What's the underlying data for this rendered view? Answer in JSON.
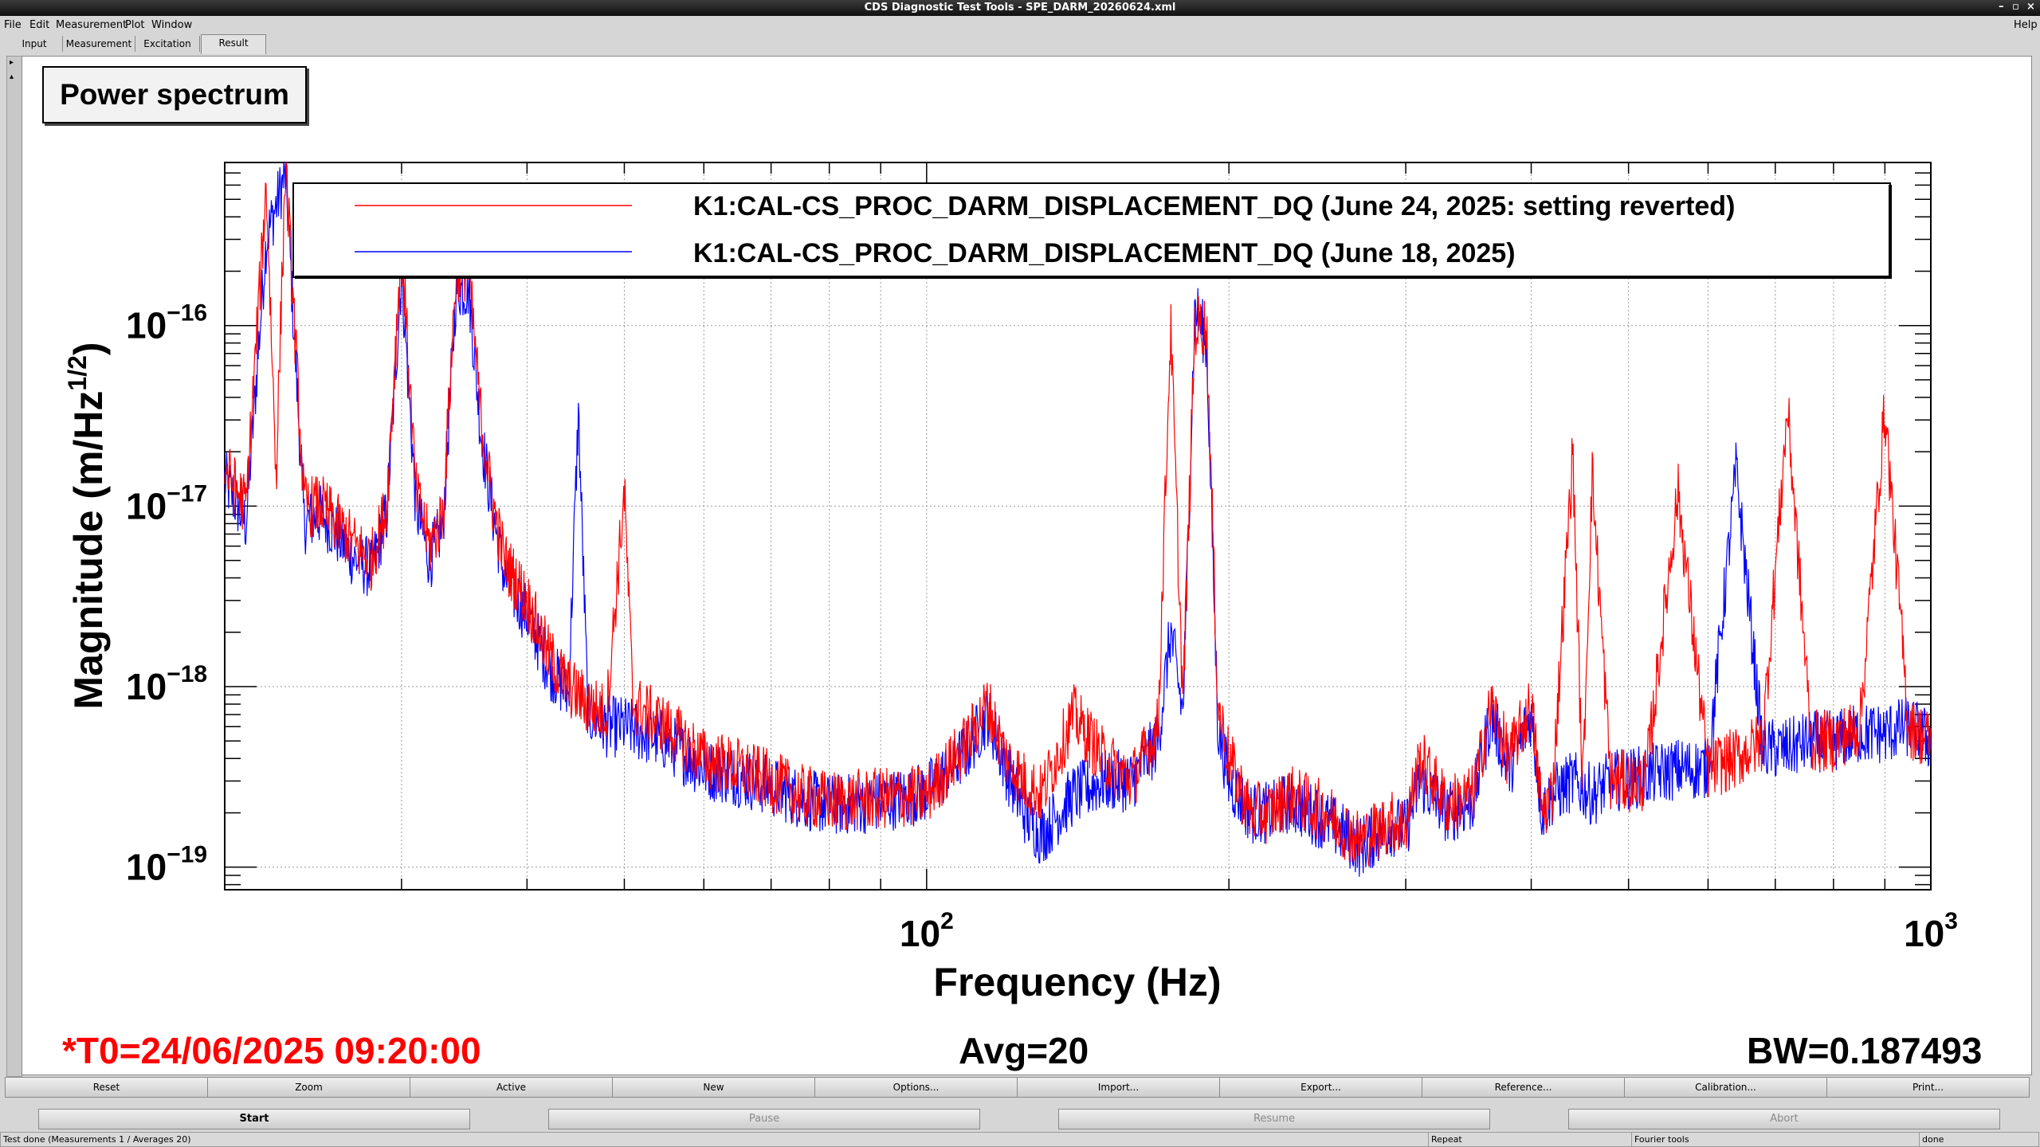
{
  "window": {
    "title": "CDS Diagnostic Test Tools - SPE_DARM_20260624.xml",
    "controls": [
      "–",
      "▫",
      "×"
    ]
  },
  "menu": {
    "items": [
      "File",
      "Edit",
      "Measurement",
      "Plot",
      "Window"
    ],
    "help": "Help"
  },
  "tabs": [
    "Input",
    "Measurement",
    "Excitation",
    "Result"
  ],
  "active_tab": "Result",
  "plot_title": "Power spectrum",
  "legend": [
    {
      "label": "K1:CAL-CS_PROC_DARM_DISPLACEMENT_DQ (June 24, 2025: setting reverted)",
      "color": "#ff0000"
    },
    {
      "label": "K1:CAL-CS_PROC_DARM_DISPLACEMENT_DQ (June 18, 2025)",
      "color": "#0000ff"
    }
  ],
  "chart_data": {
    "type": "line",
    "x_scale": "log",
    "y_scale": "log",
    "xlim": [
      20,
      1000
    ],
    "ylim": [
      7.5e-20,
      8e-16
    ],
    "xlabel": "Frequency (Hz)",
    "ylabel": "Magnitude (m/Hz^1/2)",
    "x_tick_labels": [
      {
        "value": 100,
        "base": "10",
        "exp": "2"
      },
      {
        "value": 1000,
        "base": "10",
        "exp": "3"
      }
    ],
    "y_tick_labels": [
      {
        "value": 1e-16,
        "base": "10",
        "exp": "−16"
      },
      {
        "value": 1e-17,
        "base": "10",
        "exp": "−17"
      },
      {
        "value": 1e-18,
        "base": "10",
        "exp": "−18"
      },
      {
        "value": 1e-19,
        "base": "10",
        "exp": "−19"
      }
    ],
    "grid": true,
    "series": [
      {
        "name": "K1:CAL-CS_PROC_DARM_DISPLACEMENT_DQ (June 24, 2025: setting reverted)",
        "color": "#ff0000",
        "points": [
          [
            20,
            1.6e-17
          ],
          [
            21,
            1e-17
          ],
          [
            22,
            6e-16
          ],
          [
            22.5,
            1.5e-17
          ],
          [
            23,
            8e-16
          ],
          [
            24,
            1e-17
          ],
          [
            25,
            1e-17
          ],
          [
            27,
            6e-18
          ],
          [
            28,
            5e-18
          ],
          [
            29,
            1e-17
          ],
          [
            30,
            3e-16
          ],
          [
            31,
            1.2e-17
          ],
          [
            32,
            6e-18
          ],
          [
            33,
            9e-18
          ],
          [
            34,
            2e-16
          ],
          [
            35,
            2e-16
          ],
          [
            36,
            3e-17
          ],
          [
            37,
            1e-17
          ],
          [
            38,
            5e-18
          ],
          [
            40,
            3e-18
          ],
          [
            42,
            1.5e-18
          ],
          [
            44,
            1e-18
          ],
          [
            46,
            8e-19
          ],
          [
            48,
            7e-19
          ],
          [
            50,
            1.2e-17
          ],
          [
            51,
            8e-19
          ],
          [
            55,
            6e-19
          ],
          [
            60,
            4e-19
          ],
          [
            65,
            3.5e-19
          ],
          [
            70,
            3e-19
          ],
          [
            75,
            2.5e-19
          ],
          [
            80,
            2.3e-19
          ],
          [
            90,
            2.4e-19
          ],
          [
            100,
            2.5e-19
          ],
          [
            110,
            5e-19
          ],
          [
            115,
            8e-19
          ],
          [
            120,
            4e-19
          ],
          [
            125,
            3e-19
          ],
          [
            130,
            2.5e-19
          ],
          [
            140,
            7e-19
          ],
          [
            150,
            4e-19
          ],
          [
            160,
            3e-19
          ],
          [
            170,
            6e-19
          ],
          [
            175,
            1e-16
          ],
          [
            180,
            8e-19
          ],
          [
            185,
            1e-16
          ],
          [
            190,
            1e-16
          ],
          [
            195,
            8e-19
          ],
          [
            200,
            4e-19
          ],
          [
            210,
            2e-19
          ],
          [
            220,
            2e-19
          ],
          [
            230,
            2.5e-19
          ],
          [
            250,
            2e-19
          ],
          [
            270,
            1.4e-19
          ],
          [
            290,
            1.8e-19
          ],
          [
            300,
            1.7e-19
          ],
          [
            310,
            4e-19
          ],
          [
            330,
            2.2e-19
          ],
          [
            350,
            2.5e-19
          ],
          [
            365,
            8e-19
          ],
          [
            380,
            4e-19
          ],
          [
            400,
            8e-19
          ],
          [
            410,
            2e-19
          ],
          [
            420,
            2.6e-19
          ],
          [
            440,
            2e-17
          ],
          [
            450,
            2.6e-19
          ],
          [
            460,
            1.5e-17
          ],
          [
            480,
            3e-19
          ],
          [
            520,
            3e-19
          ],
          [
            560,
            1.2e-17
          ],
          [
            600,
            3.5e-19
          ],
          [
            640,
            4e-19
          ],
          [
            680,
            5e-19
          ],
          [
            720,
            3.5e-17
          ],
          [
            760,
            5e-19
          ],
          [
            800,
            5e-19
          ],
          [
            850,
            6e-19
          ],
          [
            900,
            3.5e-17
          ],
          [
            950,
            6e-19
          ],
          [
            1000,
            5e-19
          ]
        ]
      },
      {
        "name": "K1:CAL-CS_PROC_DARM_DISPLACEMENT_DQ (June 18, 2025)",
        "color": "#0000ff",
        "points": [
          [
            20,
            1.4e-17
          ],
          [
            21,
            8e-18
          ],
          [
            22,
            3e-16
          ],
          [
            23,
            7e-16
          ],
          [
            24,
            8e-18
          ],
          [
            25,
            9e-18
          ],
          [
            27,
            5e-18
          ],
          [
            28,
            4.5e-18
          ],
          [
            29,
            9e-18
          ],
          [
            30,
            2e-16
          ],
          [
            31,
            1e-17
          ],
          [
            32,
            5e-18
          ],
          [
            33,
            8e-18
          ],
          [
            34,
            1.6e-16
          ],
          [
            35,
            1.6e-16
          ],
          [
            36,
            2.5e-17
          ],
          [
            37,
            9e-18
          ],
          [
            38,
            4e-18
          ],
          [
            40,
            2.5e-18
          ],
          [
            42,
            1.3e-18
          ],
          [
            44,
            9e-19
          ],
          [
            45,
            3.3e-17
          ],
          [
            46,
            7e-19
          ],
          [
            48,
            6e-19
          ],
          [
            50,
            6e-19
          ],
          [
            55,
            5e-19
          ],
          [
            60,
            3.5e-19
          ],
          [
            65,
            3.2e-19
          ],
          [
            70,
            2.8e-19
          ],
          [
            75,
            2.4e-19
          ],
          [
            80,
            2.2e-19
          ],
          [
            90,
            2.3e-19
          ],
          [
            100,
            2.6e-19
          ],
          [
            110,
            4.5e-19
          ],
          [
            115,
            7e-19
          ],
          [
            120,
            3.5e-19
          ],
          [
            125,
            2e-19
          ],
          [
            130,
            1.5e-19
          ],
          [
            140,
            2.5e-19
          ],
          [
            150,
            3e-19
          ],
          [
            160,
            3e-19
          ],
          [
            170,
            5e-19
          ],
          [
            175,
            2e-18
          ],
          [
            180,
            7e-19
          ],
          [
            185,
            1.3e-16
          ],
          [
            190,
            8e-17
          ],
          [
            195,
            6e-19
          ],
          [
            200,
            3e-19
          ],
          [
            210,
            2e-19
          ],
          [
            220,
            2e-19
          ],
          [
            230,
            2.3e-19
          ],
          [
            250,
            1.8e-19
          ],
          [
            270,
            1.3e-19
          ],
          [
            290,
            1.7e-19
          ],
          [
            300,
            1.6e-19
          ],
          [
            310,
            3e-19
          ],
          [
            330,
            2e-19
          ],
          [
            350,
            2.3e-19
          ],
          [
            365,
            7e-19
          ],
          [
            380,
            3.5e-19
          ],
          [
            400,
            7e-19
          ],
          [
            410,
            2e-19
          ],
          [
            420,
            2.5e-19
          ],
          [
            440,
            3e-19
          ],
          [
            460,
            2.5e-19
          ],
          [
            480,
            3e-19
          ],
          [
            520,
            3.2e-19
          ],
          [
            560,
            3.5e-19
          ],
          [
            600,
            3.5e-19
          ],
          [
            640,
            1.6e-17
          ],
          [
            680,
            4.5e-19
          ],
          [
            720,
            4.5e-19
          ],
          [
            760,
            5e-19
          ],
          [
            800,
            5e-19
          ],
          [
            850,
            5.5e-19
          ],
          [
            900,
            5.5e-19
          ],
          [
            950,
            6e-19
          ],
          [
            1000,
            5e-19
          ]
        ]
      }
    ]
  },
  "info": {
    "t0": "*T0=24/06/2025 09:20:00",
    "avg": "Avg=20",
    "bw": "BW=0.187493"
  },
  "plot_buttons": [
    "Reset",
    "Zoom",
    "Active",
    "New",
    "Options...",
    "Import...",
    "Export...",
    "Reference...",
    "Calibration...",
    "Print..."
  ],
  "run_buttons": [
    {
      "label": "Start",
      "enabled": true
    },
    {
      "label": "Pause",
      "enabled": false
    },
    {
      "label": "Resume",
      "enabled": false
    },
    {
      "label": "Abort",
      "enabled": false
    }
  ],
  "status": {
    "message": "Test done (Measurements 1 / Averages 20)",
    "repeat": "Repeat",
    "fourier": "Fourier tools",
    "state": "done"
  }
}
